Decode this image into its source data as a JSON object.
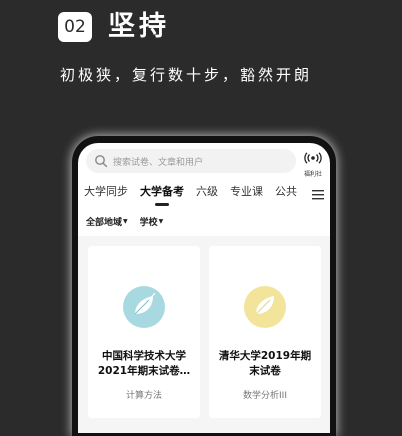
{
  "header": {
    "badge": "02",
    "title": "坚持",
    "subtitle": "初极狭，复行数十步，豁然开朗"
  },
  "phone": {
    "search": {
      "placeholder": "搜索试卷、文章和用户"
    },
    "radio_label": "福利社",
    "tabs": [
      {
        "label": "大学同步",
        "active": false
      },
      {
        "label": "大学备考",
        "active": true
      },
      {
        "label": "六级",
        "active": false
      },
      {
        "label": "专业课",
        "active": false
      },
      {
        "label": "公共",
        "active": false
      }
    ],
    "filters": [
      {
        "label": "全部地域"
      },
      {
        "label": "学校"
      }
    ],
    "cards": [
      {
        "title": "中国科学技术大学2021年期末试卷…",
        "subtitle": "计算方法",
        "thumb_color": "#a8d8e0",
        "leaf_icon": "leaf-icon"
      },
      {
        "title": "清华大学2019年期末试卷",
        "subtitle": "数学分析III",
        "thumb_color": "#f2e49a",
        "leaf_icon": "leaf-icon"
      }
    ]
  }
}
